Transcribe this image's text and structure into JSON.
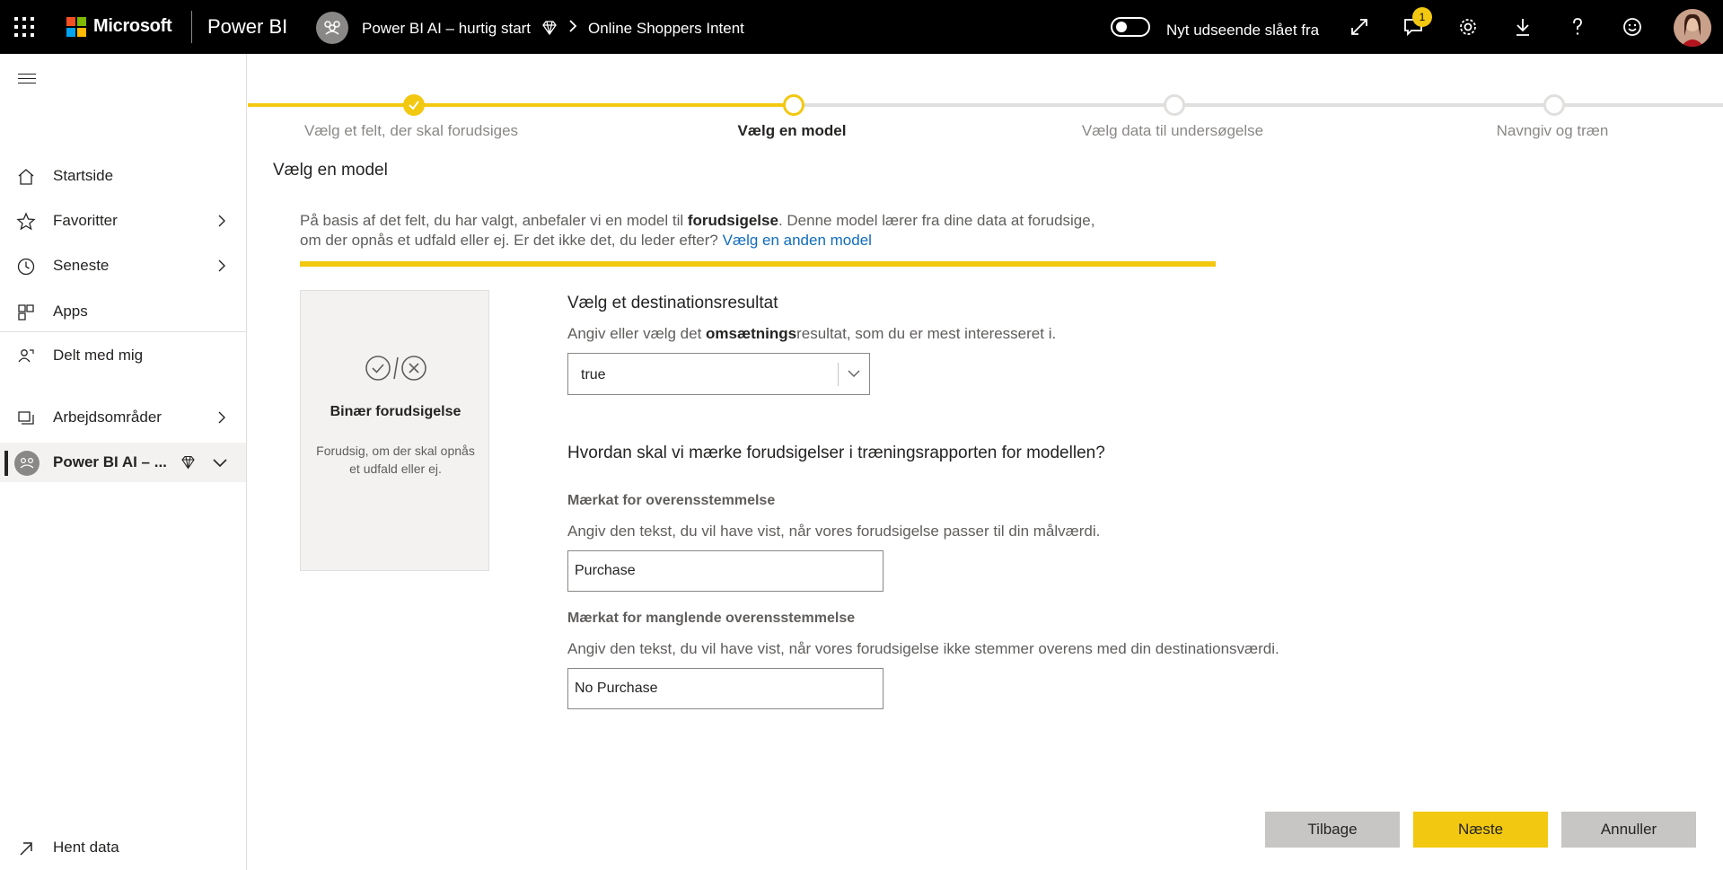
{
  "topbar": {
    "brand": "Microsoft",
    "product": "Power BI",
    "workspace": "Power BI AI – hurtig start",
    "dataset": "Online Shoppers Intent",
    "breadcrumb_separator": ">",
    "toggle_label": "Nyt udseende slået fra",
    "notification_count": "1",
    "icons": [
      "expand-icon",
      "feedback-icon",
      "settings-icon",
      "download-icon",
      "help-icon",
      "smiley-icon"
    ]
  },
  "sidebar": {
    "items": [
      {
        "label": "Startside",
        "icon": "home-icon"
      },
      {
        "label": "Favoritter",
        "icon": "star-icon"
      },
      {
        "label": "Seneste",
        "icon": "clock-icon"
      },
      {
        "label": "Apps",
        "icon": "apps-icon"
      },
      {
        "label": "Delt med mig",
        "icon": "shared-icon"
      },
      {
        "label": "Arbejdsområder",
        "icon": "workspaces-icon"
      },
      {
        "label": "Power BI AI – ...",
        "icon": "workspace-avatar"
      }
    ],
    "footer": "Hent data"
  },
  "stepper": {
    "steps": [
      {
        "label": "Vælg et felt, der skal forudsiges",
        "state": "done"
      },
      {
        "label": "Vælg en model",
        "state": "current"
      },
      {
        "label": "Vælg data til undersøgelse",
        "state": "todo"
      },
      {
        "label": "Navngiv og træn",
        "state": "todo"
      }
    ]
  },
  "main": {
    "title": "Vælg en model",
    "intro": {
      "part1": "På basis af det felt, du har valgt, anbefaler vi en model til ",
      "bold": "forudsigelse",
      "part2": ". Denne model lærer fra dine data at forudsige,",
      "part3": "om der opnås et udfald eller ej. Er det ikke det, du leder efter? ",
      "link": "Vælg en anden model"
    },
    "card": {
      "title": "Binær forudsigelse",
      "description": "Forudsig, om der skal opnås et udfald eller ej."
    },
    "target": {
      "title": "Vælg et destinationsresultat",
      "sub_part1": "Angiv eller vælg det ",
      "sub_bold": "omsætnings",
      "sub_part2": "resultat, som du er mest interesseret i.",
      "selected": "true"
    },
    "labels_section": {
      "title": "Hvordan skal vi mærke forudsigelser i træningsrapporten for modellen?",
      "match_label": "Mærkat for overensstemmelse",
      "match_help": "Angiv den tekst, du vil have vist, når vores forudsigelse passer til din målværdi.",
      "match_value": "Purchase",
      "mismatch_label": "Mærkat for manglende overensstemmelse",
      "mismatch_help": "Angiv den tekst, du vil have vist, når vores forudsigelse ikke stemmer overens med din destinationsværdi.",
      "mismatch_value": "No Purchase"
    }
  },
  "buttons": {
    "back": "Tilbage",
    "next": "Næste",
    "cancel": "Annuller"
  },
  "colors": {
    "accent": "#f2c811",
    "topbar": "#000000",
    "link": "#0f6cbd"
  }
}
